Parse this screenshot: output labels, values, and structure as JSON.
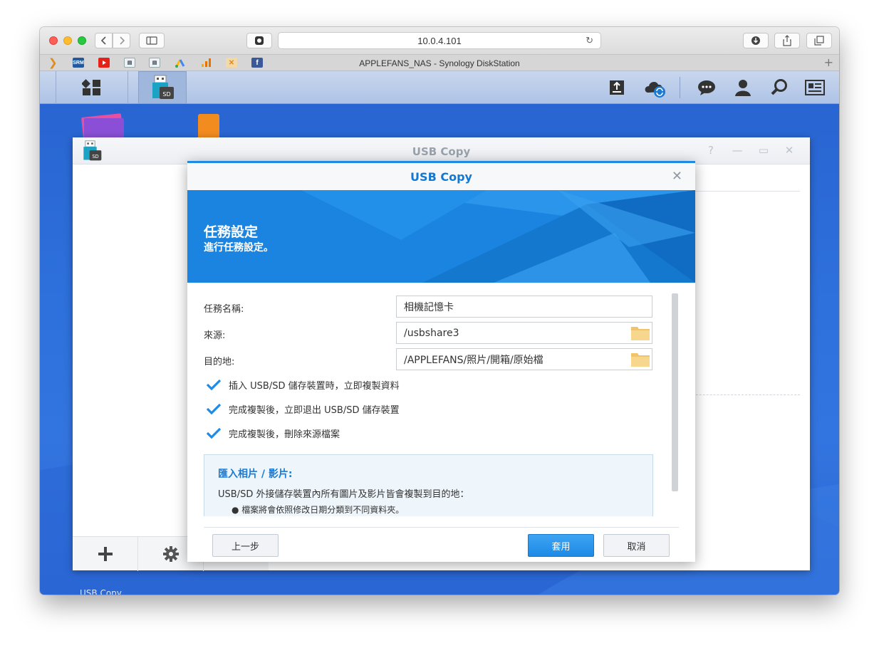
{
  "browser": {
    "address": "10.0.4.101",
    "tab_title": "APPLEFANS_NAS - Synology DiskStation",
    "favicons": [
      "SRM",
      "youtube",
      "dsm-1",
      "dsm-2",
      "google-ads",
      "analytics",
      "x-app",
      "facebook"
    ]
  },
  "app_window": {
    "title": "USB Copy"
  },
  "modal": {
    "title": "USB Copy",
    "close_label": "✕",
    "banner_title": "任務設定",
    "banner_subtitle": "進行任務設定。",
    "fields": [
      {
        "label": "任務名稱:",
        "value": "相機記憶卡"
      },
      {
        "label": "來源:",
        "value": "/usbshare3"
      },
      {
        "label": "目的地:",
        "value": "/APPLEFANS/照片/開箱/原始檔"
      }
    ],
    "checkboxes": [
      {
        "label": "插入 USB/SD 儲存裝置時，立即複製資料",
        "checked": true
      },
      {
        "label": "完成複製後，立即退出 USB/SD 儲存裝置",
        "checked": true
      },
      {
        "label": "完成複製後，刪除來源檔案",
        "checked": true
      }
    ],
    "info": {
      "title": "匯入相片 / 影片:",
      "text": "USB/SD 外接儲存裝置內所有圖片及影片皆會複製到目的地：",
      "bullet": "檔案將會依照修改日期分類到不同資料夾。"
    },
    "buttons": {
      "back": "上一步",
      "apply": "套用",
      "cancel": "取消"
    }
  },
  "colors": {
    "accent": "#1d8ae6",
    "desktop": "#2d6fdb",
    "checkbox": "#1e8be6"
  }
}
